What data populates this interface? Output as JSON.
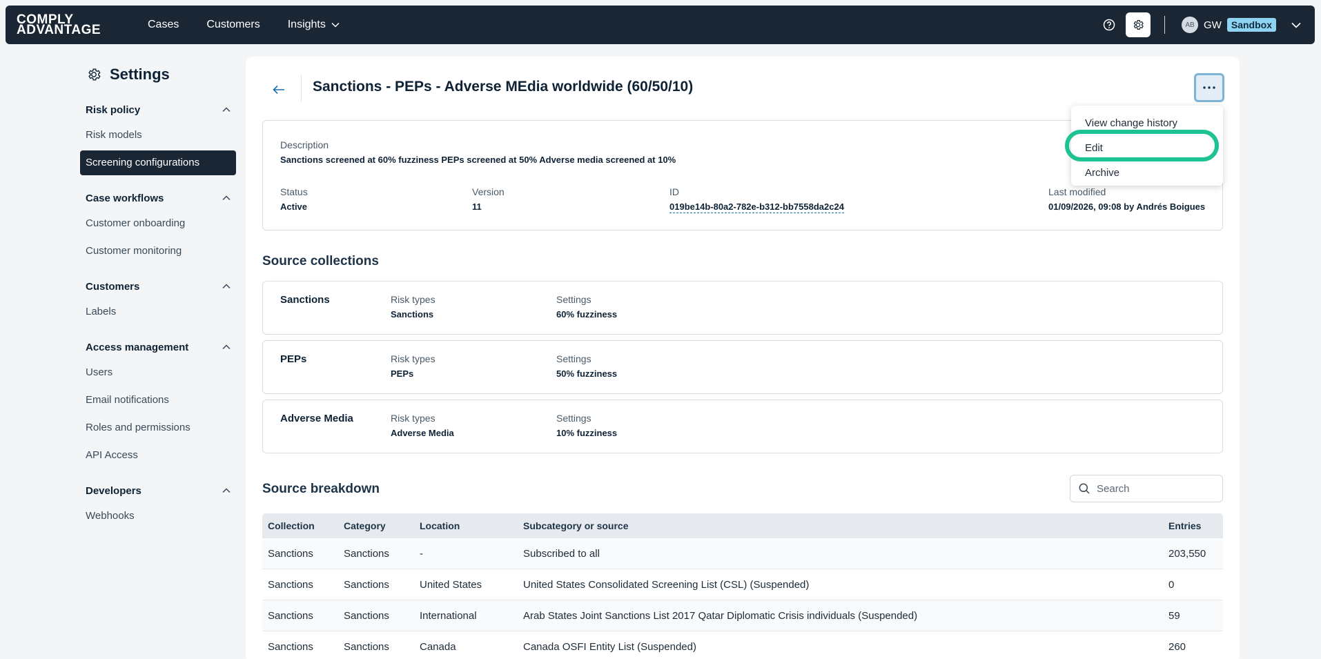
{
  "topbar": {
    "logo_line1": "COMPLY",
    "logo_line2": "ADVANTAGE",
    "nav": [
      "Cases",
      "Customers",
      "Insights"
    ],
    "user_initials": "AB",
    "org": "GW",
    "env_badge": "Sandbox"
  },
  "sidebar": {
    "title": "Settings",
    "sections": [
      {
        "label": "Risk policy",
        "items": [
          "Risk models",
          "Screening configurations"
        ]
      },
      {
        "label": "Case workflows",
        "items": [
          "Customer onboarding",
          "Customer monitoring"
        ]
      },
      {
        "label": "Customers",
        "items": [
          "Labels"
        ]
      },
      {
        "label": "Access management",
        "items": [
          "Users",
          "Email notifications",
          "Roles and permissions",
          "API Access"
        ]
      },
      {
        "label": "Developers",
        "items": [
          "Webhooks"
        ]
      }
    ],
    "selected": "Screening configurations"
  },
  "page": {
    "title": "Sanctions - PEPs - Adverse MEdia worldwide (60/50/10)",
    "description_label": "Description",
    "description": "Sanctions screened at 60% fuzziness PEPs screened at 50% Adverse media screened at 10%",
    "status_label": "Status",
    "status": "Active",
    "version_label": "Version",
    "version": "11",
    "id_label": "ID",
    "id": "019be14b-80a2-782e-b312-bb7558da2c24",
    "last_modified_label": "Last modified",
    "last_modified": "01/09/2026, 09:08 by Andrés Boigues"
  },
  "source_collections": {
    "heading": "Source collections",
    "risk_types_label": "Risk types",
    "settings_label": "Settings",
    "items": [
      {
        "name": "Sanctions",
        "risk_types": "Sanctions",
        "settings": "60% fuzziness"
      },
      {
        "name": "PEPs",
        "risk_types": "PEPs",
        "settings": "50% fuzziness"
      },
      {
        "name": "Adverse Media",
        "risk_types": "Adverse Media",
        "settings": "10% fuzziness"
      }
    ]
  },
  "source_breakdown": {
    "heading": "Source breakdown",
    "search_placeholder": "Search",
    "columns": [
      "Collection",
      "Category",
      "Location",
      "Subcategory or source",
      "Entries"
    ],
    "rows": [
      [
        "Sanctions",
        "Sanctions",
        "-",
        "Subscribed to all",
        "203,550"
      ],
      [
        "Sanctions",
        "Sanctions",
        "United States",
        "United States Consolidated Screening List (CSL) (Suspended)",
        "0"
      ],
      [
        "Sanctions",
        "Sanctions",
        "International",
        "Arab States Joint Sanctions List 2017 Qatar Diplomatic Crisis individuals (Suspended)",
        "59"
      ],
      [
        "Sanctions",
        "Sanctions",
        "Canada",
        "Canada OSFI Entity List (Suspended)",
        "260"
      ]
    ]
  },
  "menu": {
    "items": [
      "View change history",
      "Edit",
      "Archive"
    ],
    "highlighted": "Edit"
  },
  "colors": {
    "nav_bg": "#1a2633",
    "sandbox_badge": "#8fd3f2",
    "highlight_ring": "#1fc293",
    "selected_item_bg": "#1a2633"
  }
}
